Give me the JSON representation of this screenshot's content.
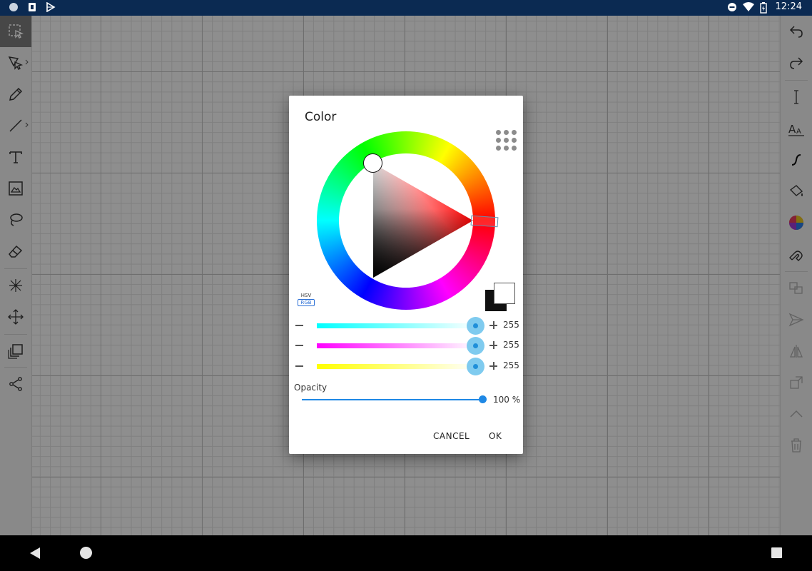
{
  "status_bar": {
    "time": "12:24",
    "left_icons": [
      "circle-icon",
      "sim-icon",
      "play-store-icon"
    ],
    "right_icons": [
      "do-not-disturb-icon",
      "wifi-icon",
      "battery-icon"
    ]
  },
  "left_toolbar": {
    "tools": [
      {
        "name": "selection-tool",
        "icon": "selection-icon",
        "active": true
      },
      {
        "name": "node-tool",
        "icon": "node-select-icon",
        "has_submenu": true
      },
      {
        "name": "pencil-tool",
        "icon": "pencil-icon"
      },
      {
        "name": "line-tool",
        "icon": "line-icon",
        "has_submenu": true
      },
      {
        "name": "text-tool",
        "icon": "text-icon"
      },
      {
        "name": "image-tool",
        "icon": "image-icon"
      },
      {
        "name": "lasso-tool",
        "icon": "lasso-icon"
      },
      {
        "name": "eraser-tool",
        "icon": "eraser-icon"
      },
      {
        "name": "symmetry-tool",
        "icon": "symmetry-icon"
      },
      {
        "name": "move-tool",
        "icon": "move-icon"
      },
      {
        "name": "layers-tool",
        "icon": "layers-icon"
      },
      {
        "name": "share-tool",
        "icon": "share-icon"
      }
    ]
  },
  "right_toolbar": {
    "tools": [
      {
        "name": "undo",
        "icon": "undo-icon"
      },
      {
        "name": "redo",
        "icon": "redo-icon"
      },
      {
        "name": "stroke-width",
        "icon": "stroke-width-icon"
      },
      {
        "name": "font",
        "icon": "font-size-icon",
        "label": "AA"
      },
      {
        "name": "stroke-style",
        "icon": "stroke-style-icon"
      },
      {
        "name": "fill",
        "icon": "fill-icon"
      },
      {
        "name": "color",
        "icon": "color-wheel-icon"
      },
      {
        "name": "snap",
        "icon": "magnet-icon"
      },
      {
        "name": "group",
        "icon": "group-icon"
      },
      {
        "name": "send",
        "icon": "send-icon"
      },
      {
        "name": "flip",
        "icon": "flip-icon"
      },
      {
        "name": "transform",
        "icon": "transform-icon"
      },
      {
        "name": "collapse",
        "icon": "chevron-up-icon"
      },
      {
        "name": "delete",
        "icon": "trash-icon"
      }
    ]
  },
  "color_dialog": {
    "title": "Color",
    "mode_hsv": "HSV",
    "mode_rgb": "RGB",
    "current_color": "#ff0000",
    "foreground_swatch": "#ffffff",
    "background_swatch": "#111111",
    "channels": [
      {
        "name": "cyan",
        "value": "255",
        "color": "#00ffff"
      },
      {
        "name": "magenta",
        "value": "255",
        "color": "#ff00ff"
      },
      {
        "name": "yellow",
        "value": "255",
        "color": "#ffff00"
      }
    ],
    "opacity_label": "Opacity",
    "opacity_value": "100 %",
    "opacity_fraction": 1.0,
    "cancel_label": "CANCEL",
    "ok_label": "OK",
    "accent_color": "#1e88e5"
  },
  "nav_bar": {
    "icons": [
      "back-icon",
      "home-icon",
      "recents-icon"
    ]
  }
}
